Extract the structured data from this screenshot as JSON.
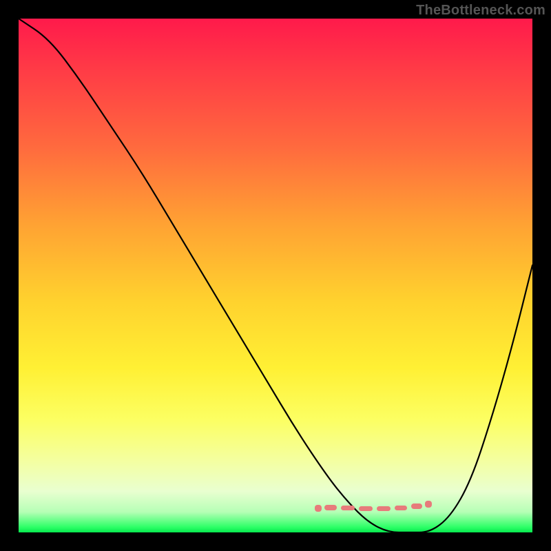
{
  "attribution": "TheBottleneck.com",
  "chart_data": {
    "type": "line",
    "title": "",
    "xlabel": "",
    "ylabel": "",
    "xlim": [
      0,
      100
    ],
    "ylim": [
      0,
      100
    ],
    "series": [
      {
        "name": "bottleneck-curve",
        "x": [
          0,
          6,
          12,
          18,
          24,
          30,
          36,
          42,
          48,
          54,
          60,
          64,
          68,
          72,
          76,
          80,
          84,
          88,
          92,
          96,
          100
        ],
        "values": [
          100,
          96,
          88,
          79,
          70,
          60,
          50,
          40,
          30,
          20,
          11,
          6,
          2,
          0,
          0,
          0,
          3,
          10,
          22,
          36,
          52
        ]
      }
    ],
    "annotations": {
      "ideal_range_x": [
        64,
        82
      ],
      "ideal_range_y_approx": 2
    },
    "grid": false,
    "legend": false,
    "background_gradient": [
      "#ff1a4b",
      "#ffd22e",
      "#fcff62",
      "#07e84e"
    ]
  },
  "colors": {
    "frame": "#000000",
    "curve": "#000000",
    "marker": "#e77b7b",
    "attribution": "#555555"
  }
}
